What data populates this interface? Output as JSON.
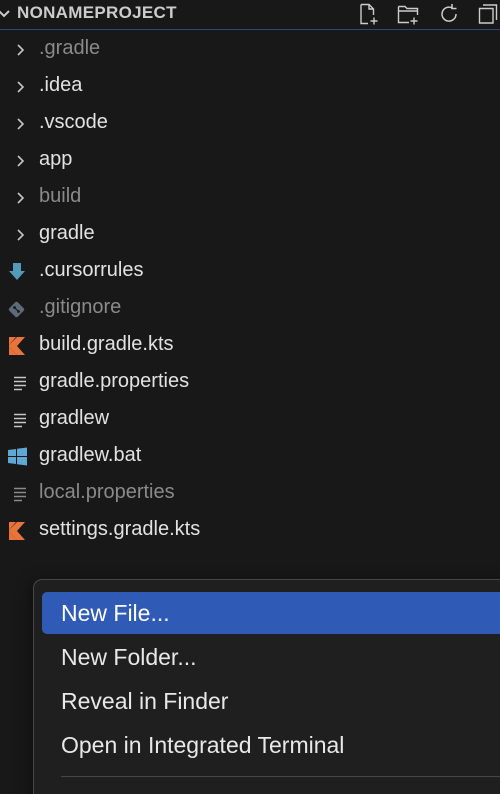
{
  "explorer": {
    "title": "NONAMEPROJECT",
    "toolbar": {
      "new_file": "new-file-icon",
      "new_folder": "new-folder-icon",
      "refresh": "refresh-icon",
      "collapse": "collapse-icon"
    },
    "items": [
      {
        "label": ".gradle",
        "kind": "folder",
        "dimmed": true
      },
      {
        "label": ".idea",
        "kind": "folder",
        "dimmed": false
      },
      {
        "label": ".vscode",
        "kind": "folder",
        "dimmed": false
      },
      {
        "label": "app",
        "kind": "folder",
        "dimmed": false
      },
      {
        "label": "build",
        "kind": "folder",
        "dimmed": true
      },
      {
        "label": "gradle",
        "kind": "folder",
        "dimmed": false
      },
      {
        "label": ".cursorrules",
        "kind": "download-file",
        "dimmed": false
      },
      {
        "label": ".gitignore",
        "kind": "git-file",
        "dimmed": true
      },
      {
        "label": "build.gradle.kts",
        "kind": "kotlin-file",
        "dimmed": false
      },
      {
        "label": "gradle.properties",
        "kind": "text-file",
        "dimmed": false
      },
      {
        "label": "gradlew",
        "kind": "text-file",
        "dimmed": false
      },
      {
        "label": "gradlew.bat",
        "kind": "windows-file",
        "dimmed": false
      },
      {
        "label": "local.properties",
        "kind": "text-file",
        "dimmed": true
      },
      {
        "label": "settings.gradle.kts",
        "kind": "kotlin-file",
        "dimmed": false
      }
    ]
  },
  "context_menu": {
    "items": [
      {
        "label": "New File...",
        "active": true
      },
      {
        "label": "New Folder...",
        "active": false
      },
      {
        "label": "Reveal in Finder",
        "active": false
      },
      {
        "label": "Open in Integrated Terminal",
        "active": false
      }
    ]
  },
  "colors": {
    "background": "#181818",
    "menu_highlight": "#2f5bb7",
    "kotlin_orange": "#e8743b",
    "cursorrules_blue": "#519aba",
    "windows_blue": "#5fa8d3"
  }
}
